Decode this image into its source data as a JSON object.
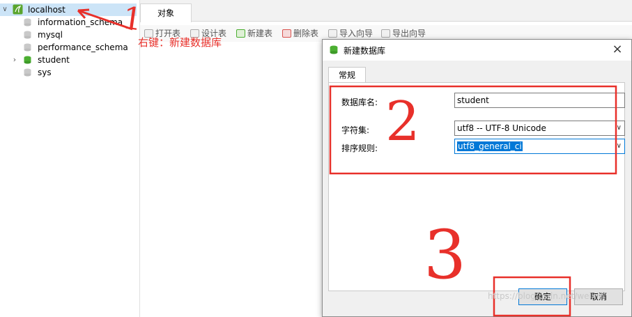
{
  "tree": {
    "connection": "localhost",
    "databases": [
      "information_schema",
      "mysql",
      "performance_schema",
      "student",
      "sys"
    ]
  },
  "tabs": {
    "objects": "对象"
  },
  "toolbar": {
    "open": "打开表",
    "design": "设计表",
    "new": "新建表",
    "delete": "删除表",
    "import": "导入向导",
    "export": "导出向导"
  },
  "dialog": {
    "title": "新建数据库",
    "tab_general": "常规",
    "db_name_label": "数据库名:",
    "db_name_value": "student",
    "charset_label": "字符集:",
    "charset_value": "utf8 -- UTF-8 Unicode",
    "collation_label": "排序规则:",
    "collation_value": "utf8_general_ci",
    "ok": "确定",
    "cancel": "取消"
  },
  "annotations": {
    "step1_text": "右键：新建数据库",
    "step1_num": "1",
    "step2_num": "2",
    "step3_num": "3",
    "color": "#e8302a"
  },
  "watermark": "https://blog.csdn.net/weixin"
}
